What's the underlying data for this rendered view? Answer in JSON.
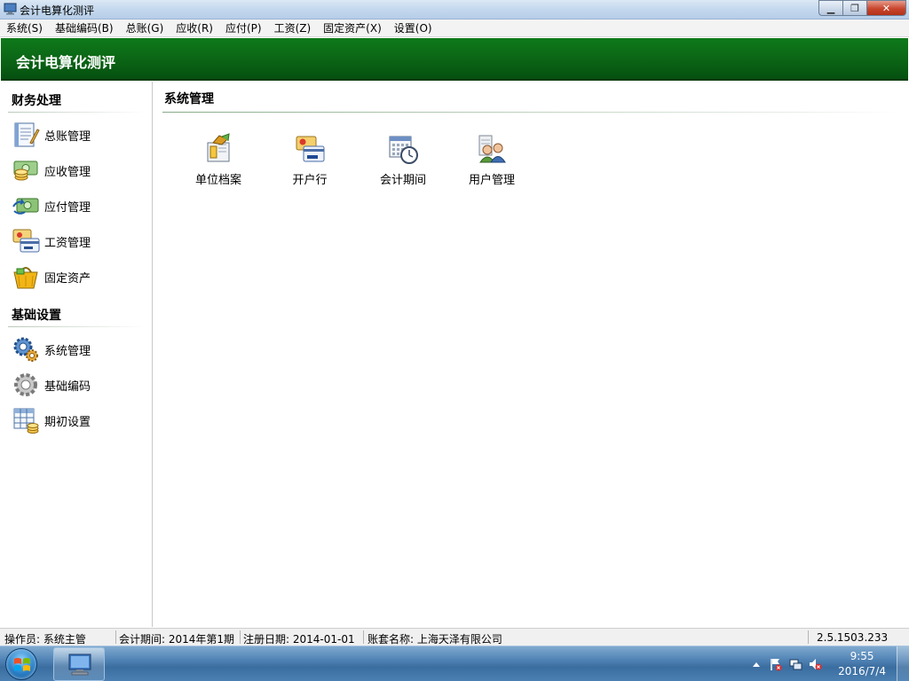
{
  "window": {
    "title": "会计电算化测评",
    "minimize_glyph": "▁",
    "maximize_glyph": "❐",
    "close_glyph": "✕"
  },
  "menu": [
    {
      "label": "系统(S)"
    },
    {
      "label": "基础编码(B)"
    },
    {
      "label": "总账(G)"
    },
    {
      "label": "应收(R)"
    },
    {
      "label": "应付(P)"
    },
    {
      "label": "工资(Z)"
    },
    {
      "label": "固定资产(X)"
    },
    {
      "label": "设置(O)"
    }
  ],
  "banner": {
    "title": "会计电算化测评"
  },
  "sidebar": {
    "sections": [
      {
        "title": "财务处理",
        "items": [
          {
            "label": "总账管理",
            "icon": "ledger-notebook-icon"
          },
          {
            "label": "应收管理",
            "icon": "receivable-coins-icon"
          },
          {
            "label": "应付管理",
            "icon": "payable-money-icon"
          },
          {
            "label": "工资管理",
            "icon": "salary-cards-icon"
          },
          {
            "label": "固定资产",
            "icon": "fixed-assets-basket-icon"
          }
        ]
      },
      {
        "title": "基础设置",
        "items": [
          {
            "label": "系统管理",
            "icon": "system-gears-icon"
          },
          {
            "label": "基础编码",
            "icon": "base-code-gear-icon"
          },
          {
            "label": "期初设置",
            "icon": "opening-settings-table-icon"
          }
        ]
      }
    ]
  },
  "main": {
    "title": "系统管理",
    "tiles": [
      {
        "label": "单位档案",
        "icon": "unit-archive-icon"
      },
      {
        "label": "开户行",
        "icon": "bank-card-icon"
      },
      {
        "label": "会计期间",
        "icon": "calendar-clock-icon"
      },
      {
        "label": "用户管理",
        "icon": "users-icon"
      }
    ]
  },
  "status": {
    "operator": "操作员: 系统主管",
    "period": "会计期间: 2014年第1期",
    "register_date": "注册日期: 2014-01-01",
    "account_name": "账套名称: 上海天泽有限公司",
    "version": "2.5.1503.233"
  },
  "taskbar": {
    "time": "9:55",
    "date": "2016/7/4"
  },
  "colors": {
    "banner": "#0b6415",
    "title_bar": "#c4d8ee",
    "taskbar": "#4f82b4"
  }
}
